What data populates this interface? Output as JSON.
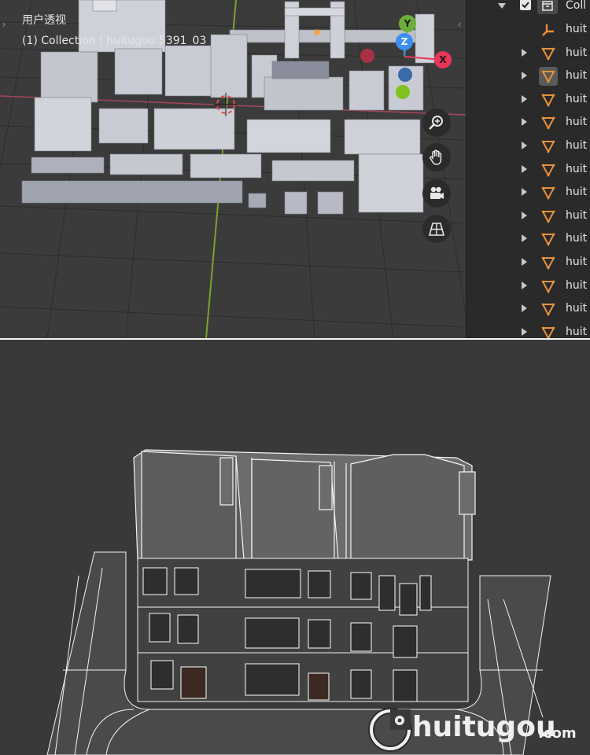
{
  "viewport": {
    "mode_label": "用户透视",
    "collection_label": "(1) Collection | huitugou 5391_03",
    "gizmo": {
      "y_label": "Y",
      "z_label": "Z",
      "x_label": "X",
      "colors": {
        "y": "#6cae3a",
        "z": "#3b8ff0",
        "x": "#e8365a",
        "neg_x": "#a83146",
        "neg_z": "#3a6aa8",
        "neg_y": "#6aaa22"
      }
    },
    "nav_buttons": [
      {
        "name": "zoom-icon"
      },
      {
        "name": "hand-pan-icon"
      },
      {
        "name": "camera-icon"
      },
      {
        "name": "grid-ortho-icon"
      }
    ]
  },
  "outliner": {
    "collection": {
      "label": "Coll",
      "checked": true
    },
    "items": [
      {
        "label": "huit",
        "icon": "empty-axes-icon",
        "has_toggle": false,
        "selected": false
      },
      {
        "label": "huit",
        "icon": "mesh-triangle-icon",
        "has_toggle": true,
        "selected": false
      },
      {
        "label": "huit",
        "icon": "mesh-triangle-icon",
        "has_toggle": true,
        "selected": true
      },
      {
        "label": "huit",
        "icon": "mesh-triangle-icon",
        "has_toggle": true,
        "selected": false
      },
      {
        "label": "huit",
        "icon": "mesh-triangle-icon",
        "has_toggle": true,
        "selected": false
      },
      {
        "label": "huit",
        "icon": "mesh-triangle-icon",
        "has_toggle": true,
        "selected": false
      },
      {
        "label": "huit",
        "icon": "mesh-triangle-icon",
        "has_toggle": true,
        "selected": false
      },
      {
        "label": "huit",
        "icon": "mesh-triangle-icon",
        "has_toggle": true,
        "selected": false
      },
      {
        "label": "huit",
        "icon": "mesh-triangle-icon",
        "has_toggle": true,
        "selected": false
      },
      {
        "label": "huit",
        "icon": "mesh-triangle-icon",
        "has_toggle": true,
        "selected": false
      },
      {
        "label": "huit",
        "icon": "mesh-triangle-icon",
        "has_toggle": true,
        "selected": false
      },
      {
        "label": "huit",
        "icon": "mesh-triangle-icon",
        "has_toggle": true,
        "selected": false
      },
      {
        "label": "huit",
        "icon": "mesh-triangle-icon",
        "has_toggle": true,
        "selected": false
      },
      {
        "label": "huit",
        "icon": "mesh-triangle-icon",
        "has_toggle": true,
        "selected": false
      },
      {
        "label": "huit",
        "icon": "mesh-triangle-icon",
        "has_toggle": true,
        "selected": false
      }
    ],
    "mesh_color": "#e8913a"
  },
  "watermark": {
    "brand": "huitugou",
    "suffix": ".com"
  }
}
